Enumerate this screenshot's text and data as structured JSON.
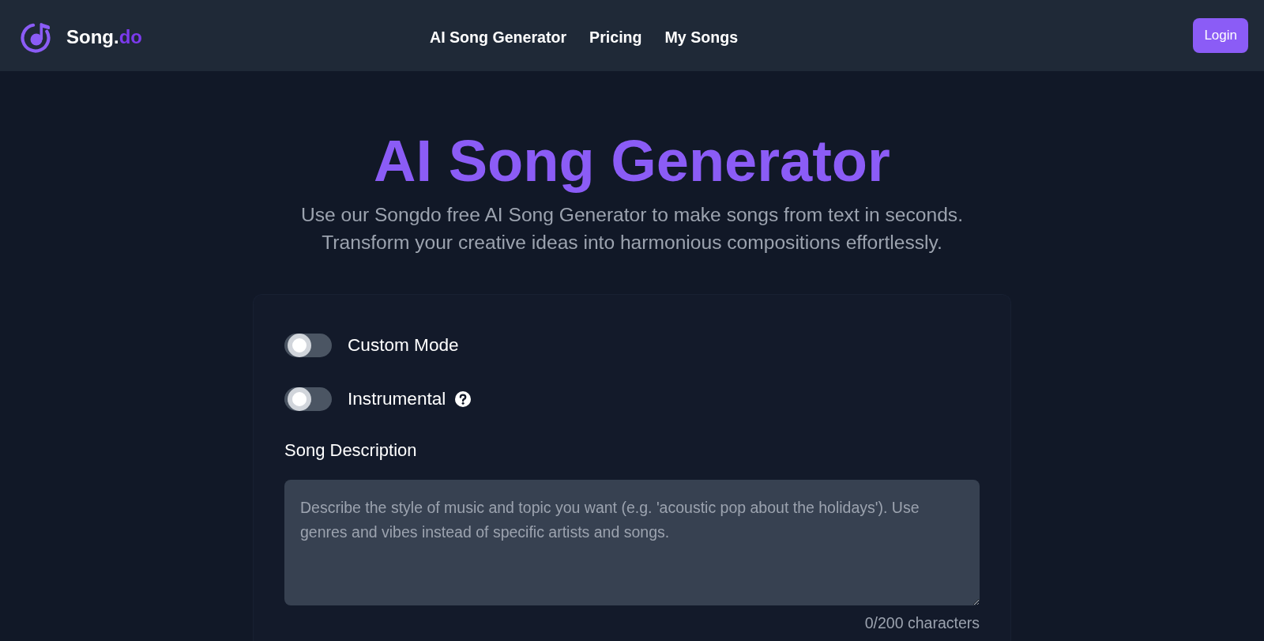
{
  "header": {
    "brand": {
      "name": "Song.",
      "accent": "do"
    },
    "nav": [
      {
        "label": "AI Song Generator"
      },
      {
        "label": "Pricing"
      },
      {
        "label": "My Songs"
      }
    ],
    "login_button": "Login"
  },
  "hero": {
    "title": "AI Song Generator",
    "subtitle": [
      "Use our Songdo free AI Song Generator to make songs from text in seconds.",
      "Transform your creative ideas into harmonious compositions effortlessly."
    ]
  },
  "form": {
    "toggles": [
      {
        "label": "Custom Mode",
        "on": false,
        "help_icon": false
      },
      {
        "label": "Instrumental",
        "on": false,
        "help_icon": true
      }
    ],
    "description": {
      "label": "Song Description",
      "placeholder": "Describe the style of music and topic you want (e.g. 'acoustic pop about the holidays'). Use genres and vibes instead of specific artists and songs.",
      "counter": "0/200 characters"
    }
  }
}
